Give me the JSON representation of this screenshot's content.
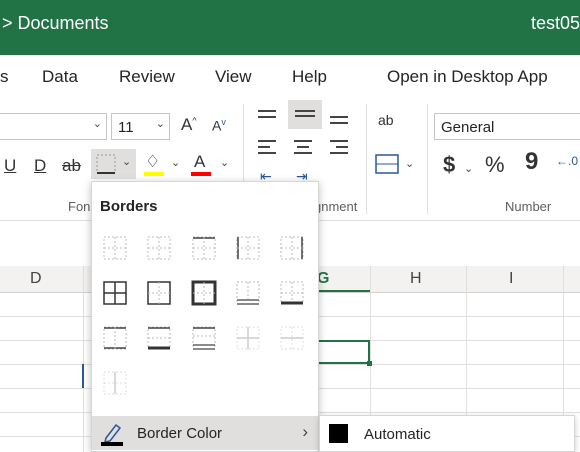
{
  "titlebar": {
    "crumb": "> Documents",
    "filename": "test05"
  },
  "menubar": {
    "items": [
      "s",
      "Data",
      "Review",
      "View",
      "Help",
      "Open in Desktop App"
    ]
  },
  "ribbon": {
    "font_size": "11",
    "number_format": "General",
    "font_group_label": "Fon",
    "alignment_group_label": "gnment",
    "number_group_label": "Number",
    "underline": "U",
    "double_underline": "D",
    "strike": "ab",
    "grow": "A",
    "shrink": "A",
    "font_color": "A",
    "currency": "$",
    "percent": "%",
    "comma": "9",
    "wrap": "ab"
  },
  "columns": [
    "D",
    "G",
    "H",
    "I"
  ],
  "borders_menu": {
    "title": "Borders",
    "border_color_label": "Border Color",
    "submenu": {
      "automatic_label": "Automatic"
    }
  },
  "colors": {
    "accent": "#217346",
    "highlight": "#ffff00",
    "font_red": "#ff0000"
  }
}
